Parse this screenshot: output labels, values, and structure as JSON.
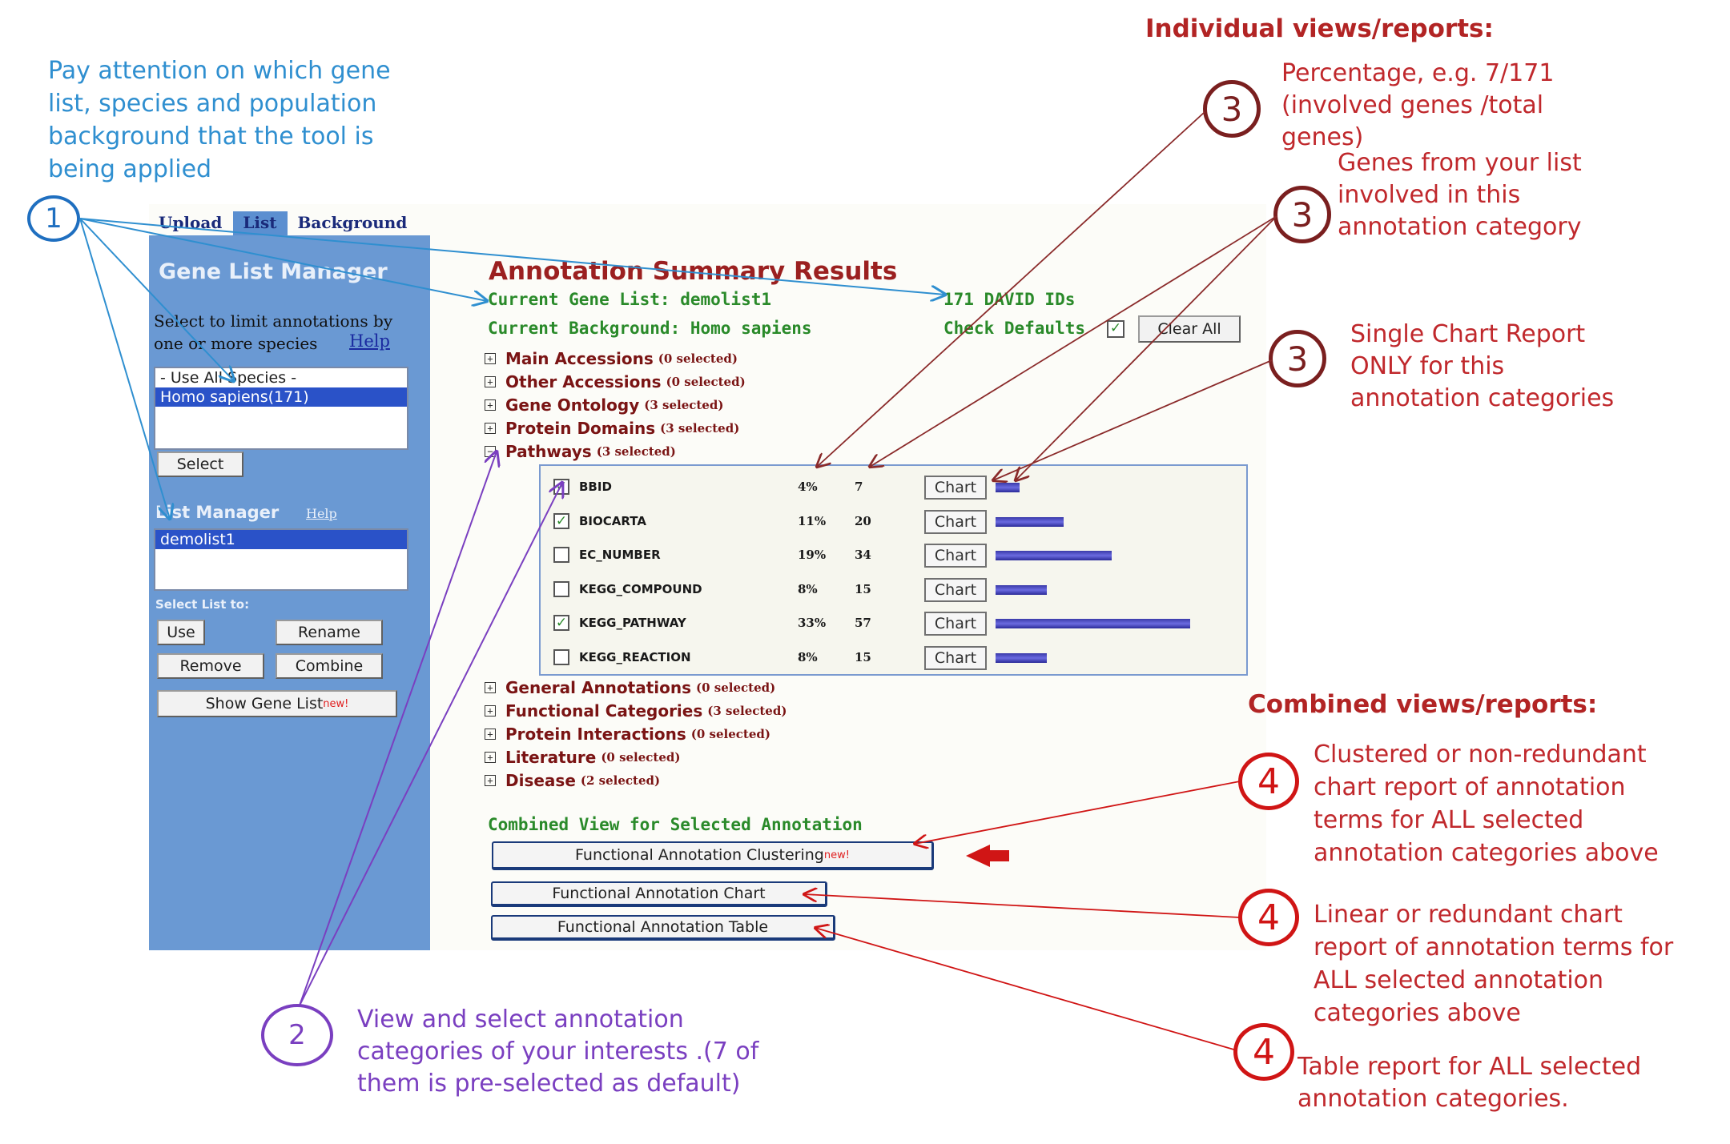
{
  "annotations": {
    "note1": [
      "Pay attention on which gene",
      "list, species and population",
      "background that the tool is",
      "being applied"
    ],
    "individual_heading": "Individual views/reports:",
    "note3a": [
      "Percentage, e.g. 7/171",
      "(involved genes /total",
      "genes)"
    ],
    "note3b": [
      "Genes from your list",
      "involved in this",
      "annotation category"
    ],
    "note3c": [
      "Single Chart Report",
      "ONLY for this",
      "annotation categories"
    ],
    "combined_heading": "Combined views/reports:",
    "note4a": [
      "Clustered or non-redundant",
      "chart report of annotation",
      "terms for ALL selected",
      "annotation categories above"
    ],
    "note4b": [
      "Linear or redundant  chart",
      "report of annotation terms for",
      "ALL selected annotation",
      "categories above"
    ],
    "note4c": [
      "Table report for ALL selected",
      "annotation categories."
    ],
    "note2": [
      "View and select annotation",
      "categories of your interests .(7 of",
      "them is pre-selected as default)"
    ],
    "circle1": "1",
    "circle2": "2",
    "circle3": "3",
    "circle4": "4"
  },
  "tabs": [
    "Upload",
    "List",
    "Background"
  ],
  "left_panel": {
    "title": "Gene List Manager",
    "species_prompt": [
      "Select to limit annotations by",
      "one or more species"
    ],
    "help": "Help",
    "species_options": [
      "- Use All Species -",
      "Homo sapiens(171)"
    ],
    "select_button": "Select",
    "list_manager": "List Manager",
    "list_items": [
      "demolist1"
    ],
    "select_list_to": "Select List to:",
    "use": "Use",
    "rename": "Rename",
    "remove": "Remove",
    "combine": "Combine",
    "show_gene_list": "Show Gene List",
    "new_tag": "new!"
  },
  "main": {
    "title": "Annotation Summary Results",
    "current_gene_list": "Current Gene List: demolist1",
    "david_ids": "171 DAVID IDs",
    "current_background": "Current Background: Homo sapiens",
    "check_defaults": "Check Defaults",
    "clear_all": "Clear All",
    "categories_top": [
      {
        "name": "Main Accessions",
        "count": "(0 selected)"
      },
      {
        "name": "Other Accessions",
        "count": "(0 selected)"
      },
      {
        "name": "Gene Ontology",
        "count": "(3 selected)"
      },
      {
        "name": "Protein Domains",
        "count": "(3 selected)"
      },
      {
        "name": "Pathways",
        "count": "(3 selected)"
      }
    ],
    "pathways": [
      {
        "name": "BBID",
        "pct": "4%",
        "count": "7",
        "checked": true,
        "bar": 0.041
      },
      {
        "name": "BIOCARTA",
        "pct": "11%",
        "count": "20",
        "checked": true,
        "bar": 0.117
      },
      {
        "name": "EC_NUMBER",
        "pct": "19%",
        "count": "34",
        "checked": false,
        "bar": 0.199
      },
      {
        "name": "KEGG_COMPOUND",
        "pct": "8%",
        "count": "15",
        "checked": false,
        "bar": 0.088
      },
      {
        "name": "KEGG_PATHWAY",
        "pct": "33%",
        "count": "57",
        "checked": true,
        "bar": 0.333
      },
      {
        "name": "KEGG_REACTION",
        "pct": "8%",
        "count": "15",
        "checked": false,
        "bar": 0.088
      }
    ],
    "chart_label": "Chart",
    "categories_bottom": [
      {
        "name": "General Annotations",
        "count": "(0 selected)"
      },
      {
        "name": "Functional Categories",
        "count": "(3 selected)"
      },
      {
        "name": "Protein Interactions",
        "count": "(0 selected)"
      },
      {
        "name": "Literature",
        "count": "(0 selected)"
      },
      {
        "name": "Disease",
        "count": "(2 selected)"
      }
    ],
    "combined_title": "Combined View for Selected Annotation",
    "clustering": "Functional Annotation Clustering",
    "chart": "Functional Annotation Chart",
    "table": "Functional Annotation Table"
  },
  "colors": {
    "blue_note": "#2f8fd0",
    "red_note": "#c0282c",
    "purple_note": "#7a3fc0",
    "panel": "#6a99d3",
    "green_text": "#2a8a2a"
  }
}
